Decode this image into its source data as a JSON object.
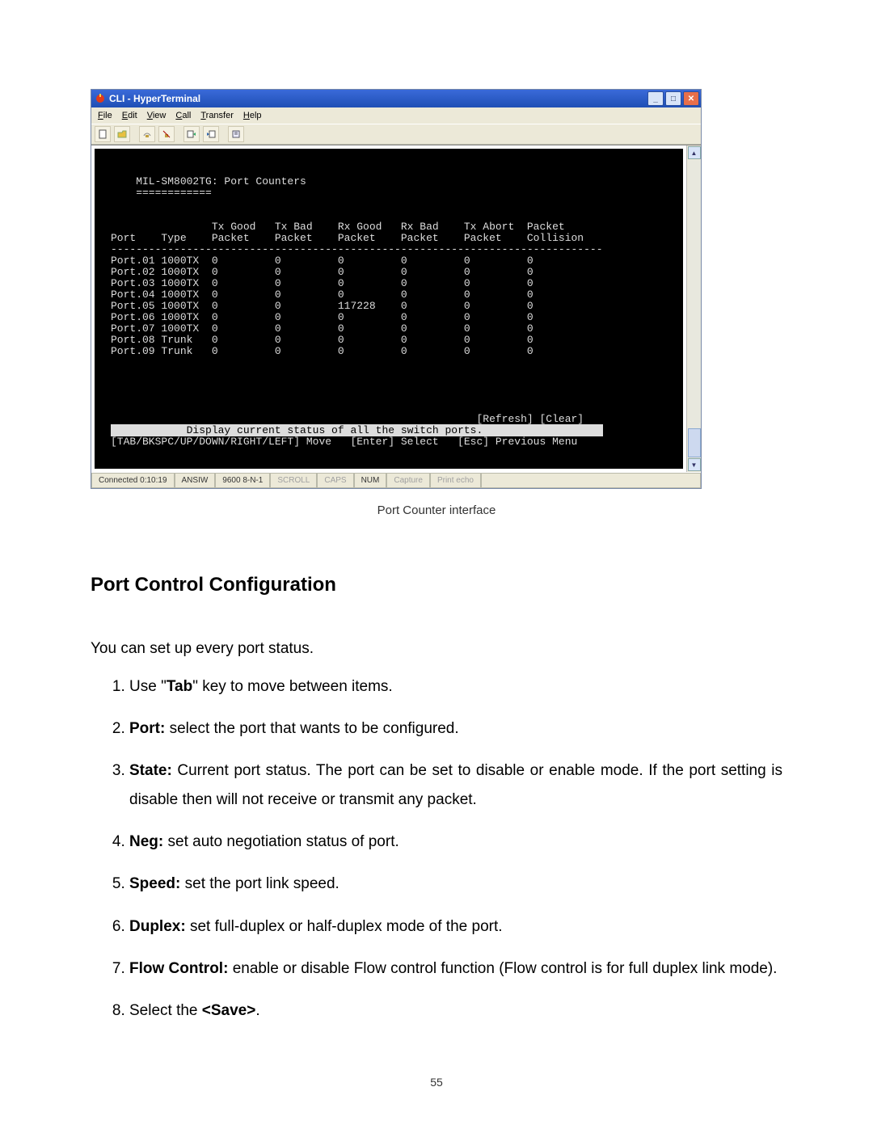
{
  "window": {
    "title": "CLI - HyperTerminal",
    "menus": [
      "File",
      "Edit",
      "View",
      "Call",
      "Transfer",
      "Help"
    ]
  },
  "toolbar_icons": [
    "new-icon",
    "open-icon",
    "connect-icon",
    "disconnect-icon",
    "send-icon",
    "receive-icon",
    "properties-icon"
  ],
  "terminal": {
    "header": "MIL-SM8002TG: Port Counters",
    "underline": "============",
    "columns": [
      "Port",
      "Type",
      "Tx Good Packet",
      "Tx Bad Packet",
      "Rx Good Packet",
      "Rx Bad Packet",
      "Tx Abort Packet",
      "Packet Collision"
    ],
    "rows": [
      {
        "port": "Port.01",
        "type": "1000TX",
        "txg": "0",
        "txb": "0",
        "rxg": "0",
        "rxb": "0",
        "txa": "0",
        "pc": "0"
      },
      {
        "port": "Port.02",
        "type": "1000TX",
        "txg": "0",
        "txb": "0",
        "rxg": "0",
        "rxb": "0",
        "txa": "0",
        "pc": "0"
      },
      {
        "port": "Port.03",
        "type": "1000TX",
        "txg": "0",
        "txb": "0",
        "rxg": "0",
        "rxb": "0",
        "txa": "0",
        "pc": "0"
      },
      {
        "port": "Port.04",
        "type": "1000TX",
        "txg": "0",
        "txb": "0",
        "rxg": "0",
        "rxb": "0",
        "txa": "0",
        "pc": "0"
      },
      {
        "port": "Port.05",
        "type": "1000TX",
        "txg": "0",
        "txb": "0",
        "rxg": "117228",
        "rxb": "0",
        "txa": "0",
        "pc": "0"
      },
      {
        "port": "Port.06",
        "type": "1000TX",
        "txg": "0",
        "txb": "0",
        "rxg": "0",
        "rxb": "0",
        "txa": "0",
        "pc": "0"
      },
      {
        "port": "Port.07",
        "type": "1000TX",
        "txg": "0",
        "txb": "0",
        "rxg": "0",
        "rxb": "0",
        "txa": "0",
        "pc": "0"
      },
      {
        "port": "Port.08",
        "type": "Trunk",
        "txg": "0",
        "txb": "0",
        "rxg": "0",
        "rxb": "0",
        "txa": "0",
        "pc": "0"
      },
      {
        "port": "Port.09",
        "type": "Trunk",
        "txg": "0",
        "txb": "0",
        "rxg": "0",
        "rxb": "0",
        "txa": "0",
        "pc": "0"
      }
    ],
    "actions": {
      "refresh": "[Refresh]",
      "clear": "[Clear]"
    },
    "status_line": "Display current status of all the switch ports.",
    "help_line": "[TAB/BKSPC/UP/DOWN/RIGHT/LEFT] Move   [Enter] Select   [Esc] Previous Menu"
  },
  "statusbar": {
    "connected": "Connected 0:10:19",
    "emulation": "ANSIW",
    "settings": "9600 8-N-1",
    "scroll": "SCROLL",
    "caps": "CAPS",
    "num": "NUM",
    "capture": "Capture",
    "printecho": "Print echo"
  },
  "caption": "Port Counter interface",
  "section_title": "Port Control Configuration",
  "intro": "You can set up every port status.",
  "steps": [
    {
      "pre": "Use \"",
      "bold": "Tab",
      "post": "\" key to move between items."
    },
    {
      "pre": "",
      "bold": "Port:",
      "post": " select the port that wants to be configured."
    },
    {
      "pre": "",
      "bold": "State:",
      "post": " Current port status. The port can be set to disable or enable mode. If the port setting is disable then will not receive or transmit any packet."
    },
    {
      "pre": "",
      "bold": "Neg:",
      "post": " set auto negotiation status of port."
    },
    {
      "pre": "",
      "bold": "Speed:",
      "post": " set the port link speed."
    },
    {
      "pre": "",
      "bold": "Duplex:",
      "post": " set full-duplex or half-duplex mode of the port."
    },
    {
      "pre": "",
      "bold": "Flow Control:",
      "post": " enable or disable Flow control function (Flow control is for full duplex link mode)."
    },
    {
      "pre": "Select the ",
      "bold": "<Save>",
      "post": "."
    }
  ],
  "page_number": "55"
}
